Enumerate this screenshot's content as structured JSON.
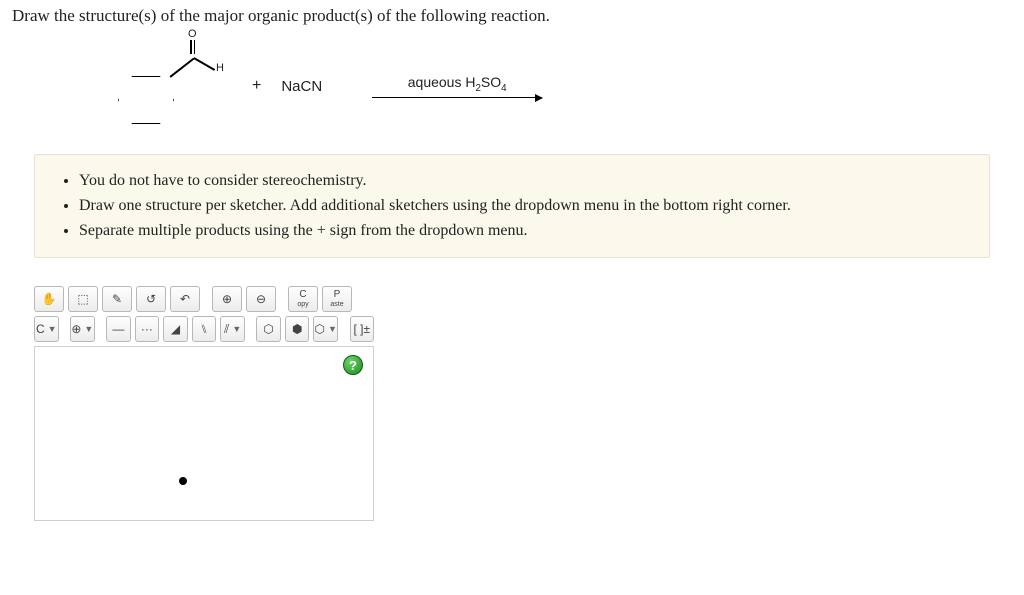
{
  "question": "Draw the structure(s) of the major organic product(s) of the following reaction.",
  "reaction": {
    "reagent1_O": "O",
    "reagent1_H": "H",
    "plus": "+",
    "reagent2": "NaCN",
    "arrowLabelPlain": "aqueous H2SO4"
  },
  "instructions": [
    "You do not have to consider stereochemistry.",
    "Draw one structure per sketcher. Add additional sketchers using the dropdown menu in the bottom right corner.",
    "Separate multiple products using the + sign from the dropdown menu."
  ],
  "toolbar": {
    "row1": {
      "hand": "✋",
      "select": "⬚",
      "draw": "✎",
      "lasso": "↺",
      "undo": "↶",
      "zoomIn": "⊕",
      "zoomOut": "⊖",
      "copyTop": "C",
      "copyBot": "opy",
      "pasteTop": "P",
      "pasteBot": "aste"
    },
    "row2": {
      "element": "C",
      "add": "⊕",
      "single": "—",
      "dots": "···",
      "wedge": "◢",
      "dash": "⑊",
      "slashes": "⫽",
      "ringBox": "⬡",
      "ringHex": "⬢",
      "ringHexO": "⬡",
      "bracket": "[ ]±"
    }
  },
  "helpBadge": "?"
}
